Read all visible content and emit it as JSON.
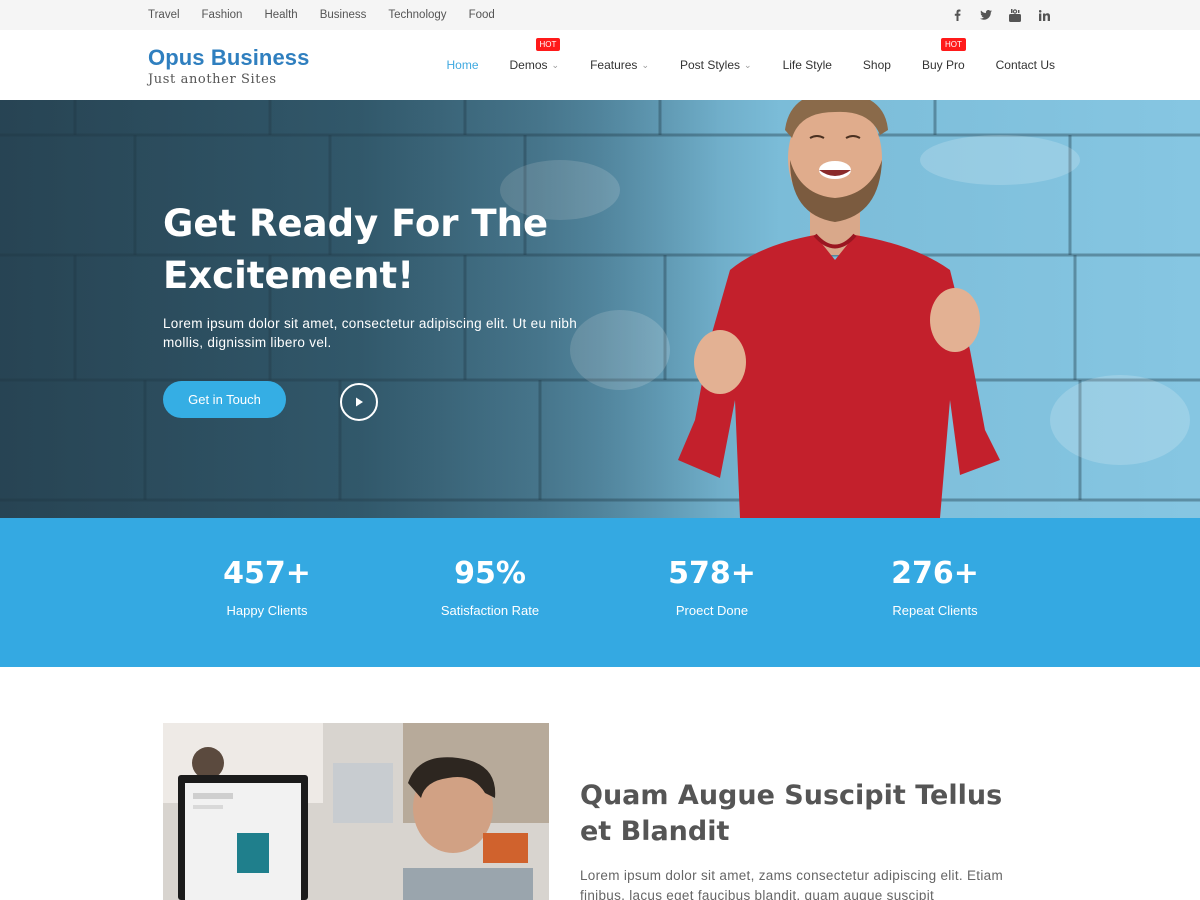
{
  "topbar": {
    "categories": [
      "Travel",
      "Fashion",
      "Health",
      "Business",
      "Technology",
      "Food"
    ],
    "social_icons": [
      "facebook-icon",
      "twitter-icon",
      "youtube-icon",
      "linkedin-icon"
    ]
  },
  "header": {
    "site_title": "Opus Business",
    "tagline": "Just another Sites",
    "nav": [
      {
        "label": "Home",
        "active": true
      },
      {
        "label": "Demos",
        "badge": "HOT",
        "dropdown": true
      },
      {
        "label": "Features",
        "dropdown": true
      },
      {
        "label": "Post Styles",
        "dropdown": true
      },
      {
        "label": "Life Style"
      },
      {
        "label": "Shop"
      },
      {
        "label": "Buy Pro",
        "badge": "HOT"
      },
      {
        "label": "Contact Us"
      }
    ]
  },
  "hero": {
    "headline": "Get Ready For The Excitement!",
    "text": "Lorem ipsum dolor sit amet, consectetur adipiscing elit. Ut eu nibh mollis, dignissim libero vel.",
    "cta_label": "Get in Touch",
    "play_icon": "play-icon"
  },
  "stats": [
    {
      "value": "457+",
      "label": "Happy Clients"
    },
    {
      "value": "95%",
      "label": "Satisfaction Rate"
    },
    {
      "value": "578+",
      "label": "Proect Done"
    },
    {
      "value": "276+",
      "label": "Repeat Clients"
    }
  ],
  "content": {
    "title": "Quam Augue Suscipit Tellus et Blandit",
    "text": "Lorem ipsum dolor sit amet, zams consectetur adipiscing elit. Etiam finibus, lacus eget faucibus blandit, quam augue suscipit"
  },
  "colors": {
    "accent": "#34a9e2",
    "brand": "#2f7fbf",
    "hot_badge": "#ff1a1a"
  }
}
